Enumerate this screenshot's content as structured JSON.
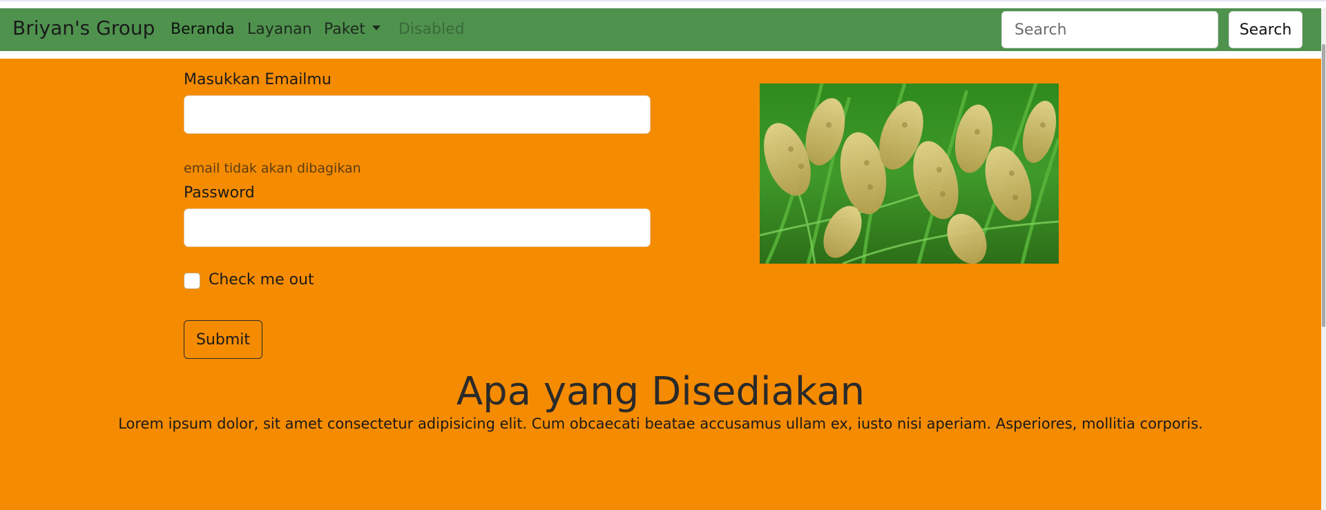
{
  "navbar": {
    "brand": "Briyan's Group",
    "links": [
      {
        "label": "Beranda"
      },
      {
        "label": "Layanan"
      },
      {
        "label": "Paket"
      },
      {
        "label": "Disabled"
      }
    ],
    "search": {
      "placeholder": "Search",
      "button_label": "Search"
    },
    "color": "#4f924e"
  },
  "form": {
    "email_label": "Masukkan Emailmu",
    "email_value": "",
    "email_help": "email tidak akan dibagikan",
    "password_label": "Password",
    "password_value": "",
    "checkbox_label": "Check me out",
    "checkbox_checked": false,
    "submit_label": "Submit"
  },
  "image": {
    "icon": "rice-plant-photo"
  },
  "section": {
    "heading": "Apa yang Disediakan",
    "paragraph": "Lorem ipsum dolor, sit amet consectetur adipisicing elit. Cum obcaecati beatae accusamus ullam ex, iusto nisi aperiam. Asperiores, mollitia corporis."
  },
  "colors": {
    "background": "#f58b00",
    "navbar": "#4f924e"
  }
}
